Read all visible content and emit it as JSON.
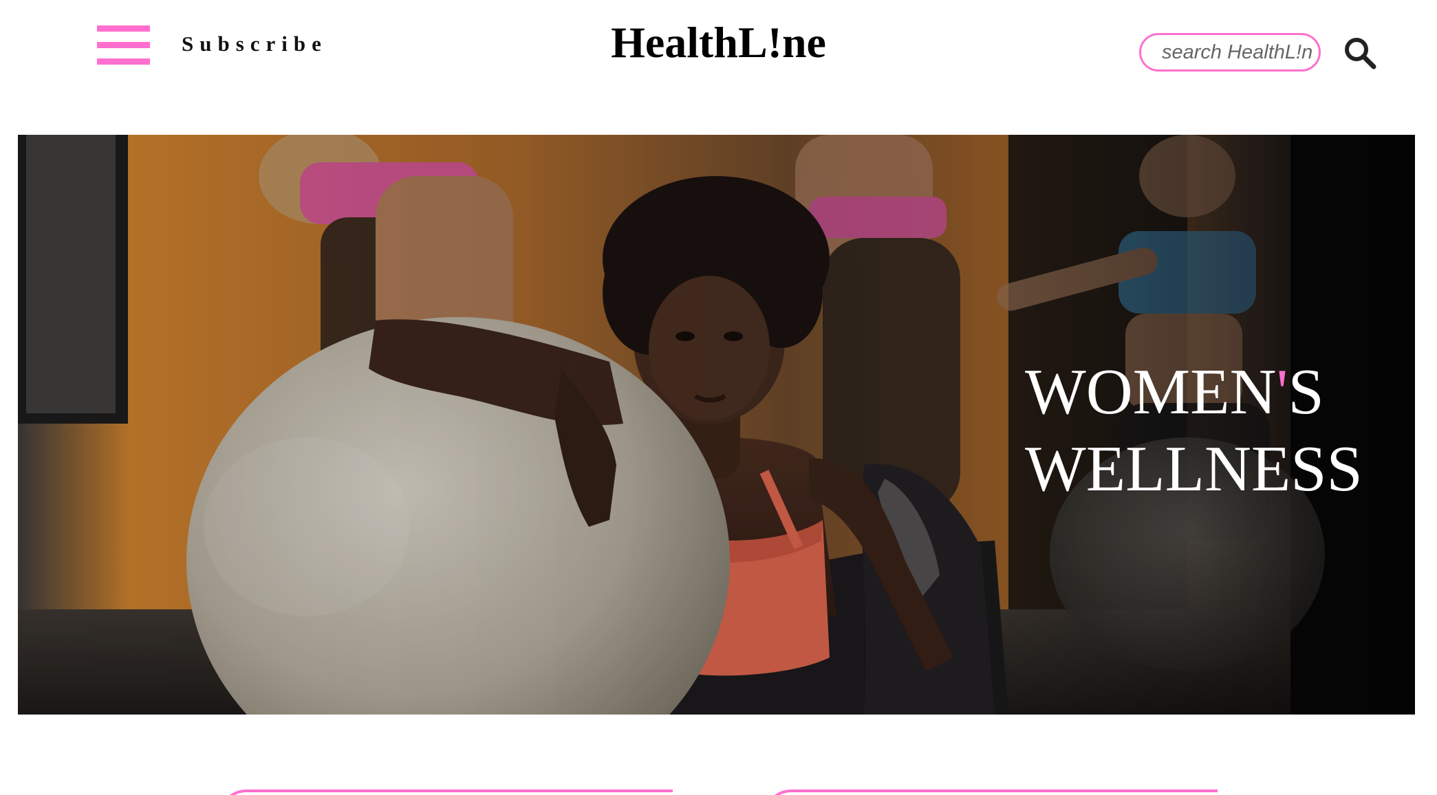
{
  "header": {
    "subscribe_label": "Subscribe",
    "logo_text": "HealthL!ne",
    "search_placeholder": "search HealthL!ne..."
  },
  "hero": {
    "title_line1_start": "WOMEN",
    "title_apostrophe": "'",
    "title_line1_end": "S",
    "title_line2": "WELLNESS"
  },
  "colors": {
    "accent": "#ff6fcf",
    "text": "#000000",
    "background": "#ffffff"
  },
  "icons": {
    "menu": "hamburger-menu-icon",
    "search": "magnifier-icon"
  }
}
